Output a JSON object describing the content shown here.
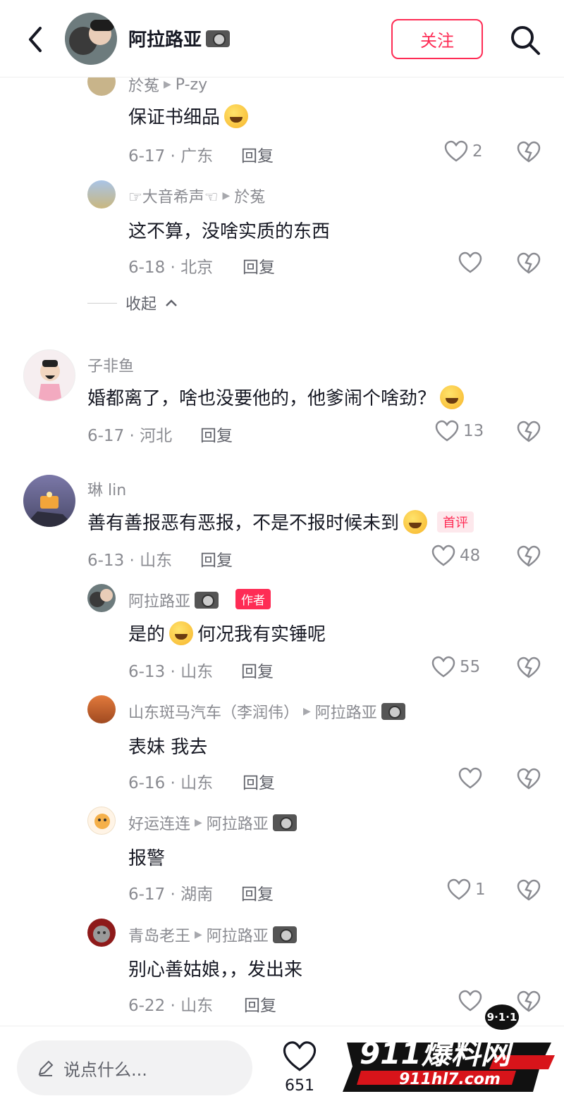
{
  "header": {
    "title": "阿拉路亚",
    "follow_label": "关注"
  },
  "comments": [
    {
      "user": "於菟",
      "reply_to": "P-zy",
      "text": "保证书细品",
      "date_location": "6-17 · 广东",
      "reply_label": "回复",
      "likes": "2"
    },
    {
      "user": "☞大音希声☜",
      "reply_to": "於菟",
      "text": "这不算，没啥实质的东西",
      "date_location": "6-18 · 北京",
      "reply_label": "回复",
      "likes": ""
    },
    {
      "user": "子非鱼",
      "text": "婚都离了，啥也没要他的，他爹闹个啥劲？",
      "date_location": "6-17 · 河北",
      "reply_label": "回复",
      "likes": "13"
    },
    {
      "user": "琳 lin",
      "text": "善有善报恶有恶报，不是不报时候未到",
      "first_badge": "首评",
      "date_location": "6-13 · 山东",
      "reply_label": "回复",
      "likes": "48"
    },
    {
      "user": "阿拉路亚",
      "author_badge": "作者",
      "text_before": "是的",
      "text_after": "何况我有实锤呢",
      "date_location": "6-13 · 山东",
      "reply_label": "回复",
      "likes": "55"
    },
    {
      "user": "山东斑马汽车（李润伟）",
      "reply_to": "阿拉路亚",
      "text": "表妹 我去",
      "date_location": "6-16 · 山东",
      "reply_label": "回复",
      "likes": ""
    },
    {
      "user": "好运连连",
      "reply_to": "阿拉路亚",
      "text": "报警",
      "date_location": "6-17 · 湖南",
      "reply_label": "回复",
      "likes": "1"
    },
    {
      "user": "青岛老王",
      "reply_to": "阿拉路亚",
      "text": "别心善姑娘，，发出来",
      "date_location": "6-22 · 山东",
      "reply_label": "回复",
      "likes": ""
    }
  ],
  "collapse_label": "收起",
  "bottom": {
    "input_placeholder": "说点什么...",
    "like_count": "651"
  },
  "watermark": {
    "badge": "9·1·1",
    "title": "911爆料网",
    "url": "911hl7.com"
  },
  "colors": {
    "accent": "#fe2c55",
    "secondary_text": "#8a8b91"
  }
}
